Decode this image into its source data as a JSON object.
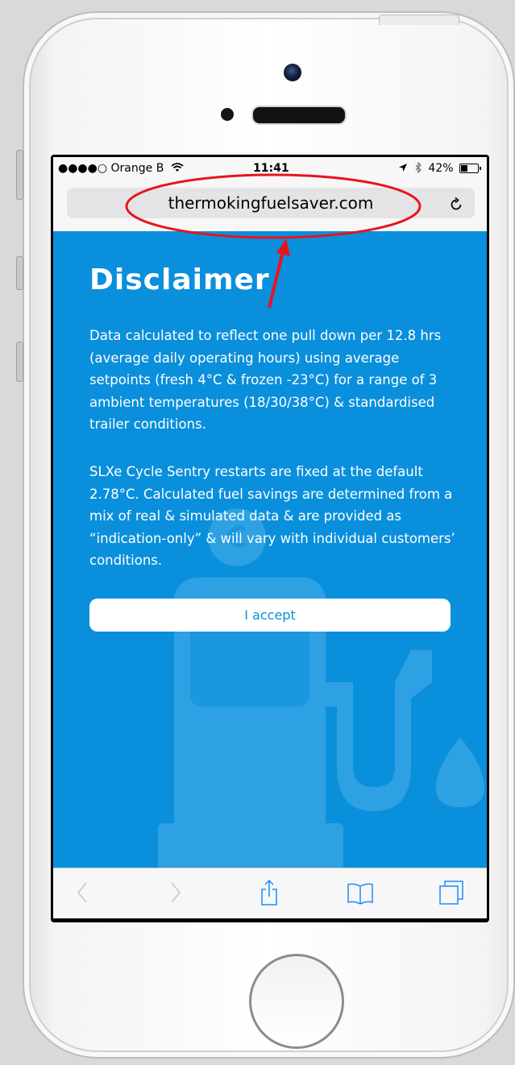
{
  "status_bar": {
    "carrier": "●●●●○ Orange B",
    "time": "11:41",
    "battery": "42%",
    "battery_level": 0.42
  },
  "browser": {
    "url": "thermokingfuelsaver.com"
  },
  "page": {
    "title": "Disclaimer",
    "paragraph_1": "Data calculated to reflect one pull down per 12.8 hrs (average daily operating hours) using average setpoints (fresh 4°C & frozen -23°C) for a range of 3 ambient temperatures (18/30/38°C) & standardised trailer conditions.",
    "paragraph_2": "SLXe Cycle Sentry restarts are fixed at the default 2.78°C. Calculated fuel savings are determined from a mix of real & simulated data & are provided as “indication-only” & will vary with individual customers’ conditions.",
    "accept_label": "I accept"
  },
  "toolbar_icons": [
    "back-icon",
    "forward-icon",
    "share-icon",
    "bookmarks-icon",
    "tabs-icon"
  ],
  "colors": {
    "page_background": "#0a8fdc",
    "annotation": "#e8141c"
  }
}
